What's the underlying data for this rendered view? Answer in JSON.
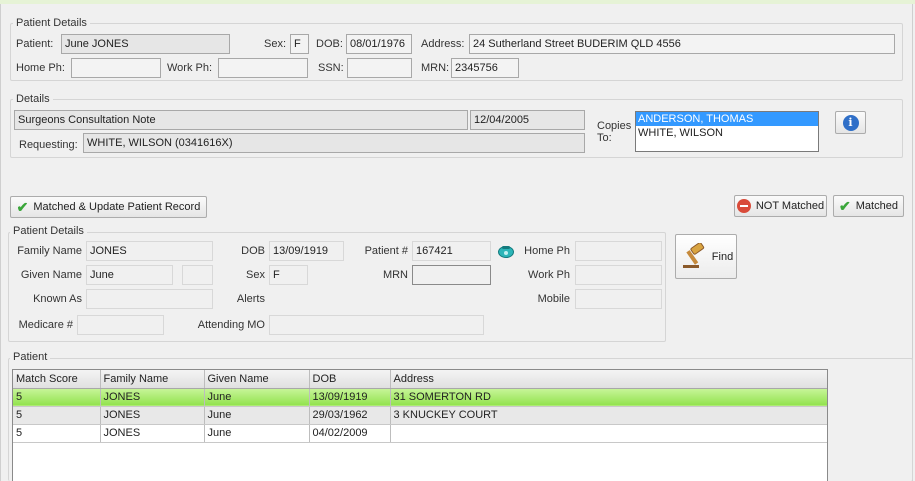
{
  "patient_details": {
    "legend": "Patient Details",
    "patient_label": "Patient:",
    "patient_value": "June JONES",
    "sex_label": "Sex:",
    "sex_value": "F",
    "dob_label": "DOB:",
    "dob_value": "08/01/1976",
    "address_label": "Address:",
    "address_value": "24 Sutherland Street BUDERIM QLD 4556",
    "home_ph_label": "Home Ph:",
    "home_ph_value": "",
    "work_ph_label": "Work Ph:",
    "work_ph_value": "",
    "ssn_label": "SSN:",
    "ssn_value": "",
    "mrn_label": "MRN:",
    "mrn_value": "2345756"
  },
  "details": {
    "legend": "Details",
    "document_title": "Surgeons Consultation Note",
    "date": "12/04/2005",
    "requesting_label": "Requesting:",
    "requesting_value": "WHITE, WILSON (0341616X)",
    "copies_label_line1": "Copies",
    "copies_label_line2": "To:",
    "copies": [
      "ANDERSON, THOMAS",
      "WHITE, WILSON"
    ],
    "info_icon": "info-icon"
  },
  "actions": {
    "match_update_label": "Matched & Update Patient Record",
    "not_matched_label": "NOT Matched",
    "matched_label": "Matched",
    "find_label": "Find"
  },
  "search": {
    "legend": "Patient Details",
    "family_name_label": "Family Name",
    "family_name_value": "JONES",
    "dob_label": "DOB",
    "dob_value": "13/09/1919",
    "patient_no_label": "Patient #",
    "patient_no_value": "167421",
    "home_ph_label": "Home Ph",
    "home_ph_value": "",
    "given_name_label": "Given Name",
    "given_name_value": "June",
    "given_name2_value": "",
    "sex_label": "Sex",
    "sex_value": "F",
    "mrn_label": "MRN",
    "mrn_value": "",
    "work_ph_label": "Work Ph",
    "work_ph_value": "",
    "known_as_label": "Known As",
    "known_as_value": "",
    "alerts_label": "Alerts",
    "mobile_label": "Mobile",
    "mobile_value": "",
    "medicare_label": "Medicare #",
    "medicare_value": "",
    "attending_label": "Attending MO",
    "attending_value": ""
  },
  "results": {
    "legend": "Patient",
    "columns": [
      "Match Score",
      "Family Name",
      "Given Name",
      "DOB",
      "Address"
    ],
    "rows": [
      [
        "5",
        "JONES",
        "June",
        "13/09/1919",
        "31 SOMERTON RD"
      ],
      [
        "5",
        "JONES",
        "June",
        "29/03/1962",
        "3 KNUCKEY COURT"
      ],
      [
        "5",
        "JONES",
        "June",
        "04/02/2009",
        ""
      ]
    ]
  },
  "colors": {
    "match_row": "#92e24d",
    "selection": "#3399ff",
    "check": "#3aa63a",
    "not_matched": "#d94b3a"
  }
}
